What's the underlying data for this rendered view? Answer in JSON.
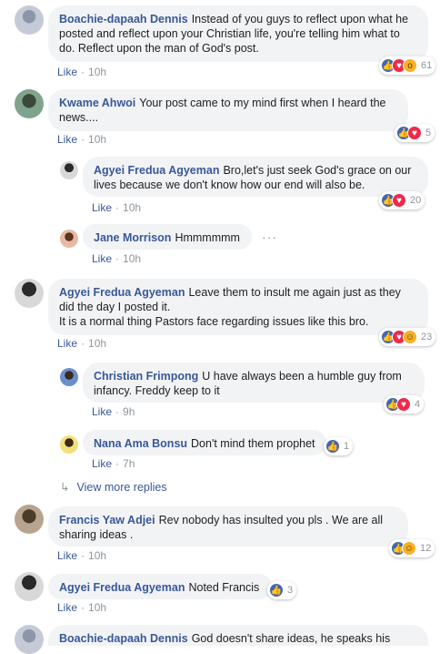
{
  "comments": [
    {
      "name": "Boachie-dapaah Dennis",
      "text": "Instead of you guys to reflect upon what he posted and reflect upon your Christian life, you're telling him what to do. Reflect upon the man of God's post.",
      "like": "Like",
      "time": "10h",
      "reactions": "61"
    },
    {
      "name": "Kwame Ahwoi",
      "text": "Your post came to my mind first when I heard the news....",
      "like": "Like",
      "time": "10h",
      "reactions": "5"
    },
    {
      "name": "Agyei Fredua Agyeman",
      "text": "Bro,let's just seek God's grace on our lives because we don't know how our end will also be.",
      "like": "Like",
      "time": "10h",
      "reactions": "20"
    },
    {
      "name": "Jane Morrison",
      "text": "Hmmmmmm",
      "like": "Like",
      "time": "10h"
    },
    {
      "name": "Agyei Fredua Agyeman",
      "text": "Leave them to insult me again just as they did the day I posted it.",
      "text2": "It is a normal thing Pastors face regarding issues like this bro.",
      "like": "Like",
      "time": "10h",
      "reactions": "23"
    },
    {
      "name": "Christian Frimpong",
      "text": "U have always been a humble guy from infancy. Freddy keep to it",
      "like": "Like",
      "time": "9h",
      "reactions": "4"
    },
    {
      "name": "Nana Ama Bonsu",
      "text": "Don't mind them prophet",
      "like": "Like",
      "time": "7h",
      "reactions": "1"
    },
    {
      "name": "Francis Yaw Adjei",
      "text": "Rev nobody has insulted you pls . We are all sharing ideas .",
      "like": "Like",
      "time": "10h",
      "reactions": "12"
    },
    {
      "name": "Agyei Fredua Agyeman",
      "text": "Noted Francis",
      "like": "Like",
      "time": "10h",
      "reactions": "3"
    },
    {
      "name": "Boachie-dapaah Dennis",
      "text": "God doesn't share ideas, he speaks his"
    }
  ],
  "view_more": "View more replies",
  "more_dots": "···"
}
